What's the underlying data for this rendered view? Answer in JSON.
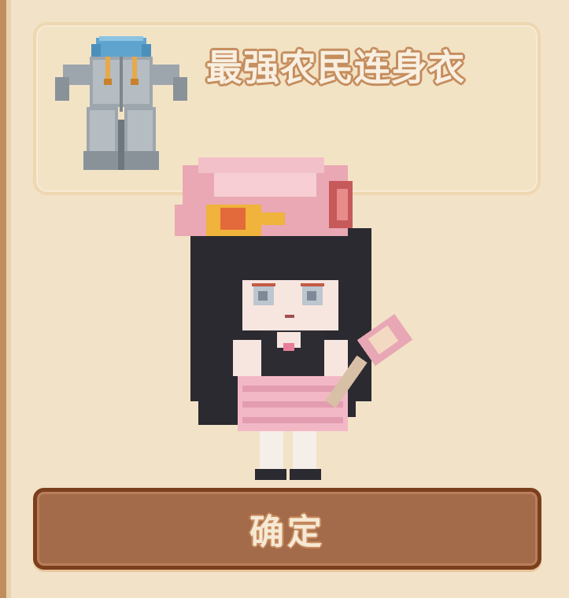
{
  "item": {
    "name": "最强农民连身衣",
    "icon": "overalls-icon"
  },
  "character": {
    "avatar": "chibi-girl-avatar"
  },
  "actions": {
    "confirm_label": "确定"
  },
  "colors": {
    "background": "#f2e2c7",
    "card_border": "#eed7b1",
    "button_fill": "#a46b4a",
    "button_border": "#7b3f1d",
    "text_light": "#f8efe1",
    "text_outline": "#c58d5d"
  }
}
